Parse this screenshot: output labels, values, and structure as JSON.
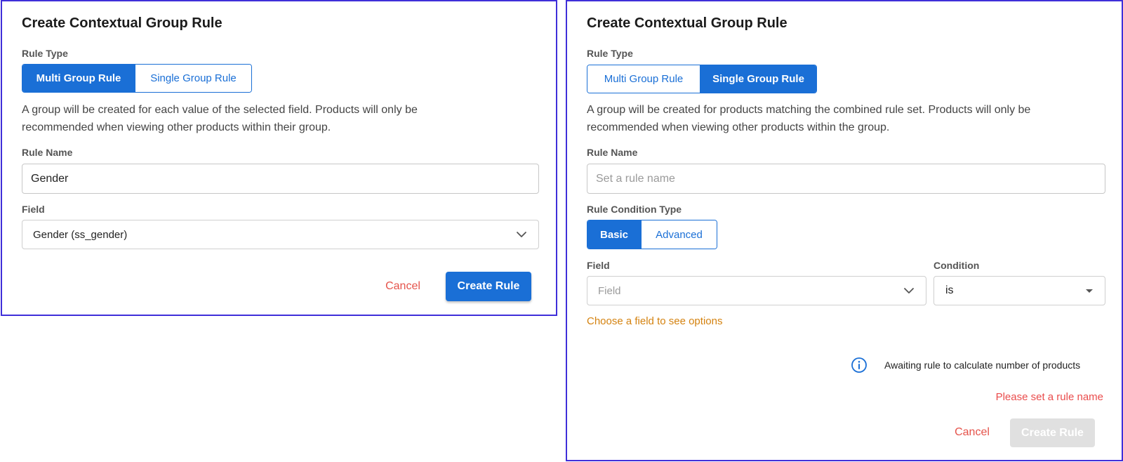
{
  "left": {
    "title": "Create Contextual Group Rule",
    "rule_type_label": "Rule Type",
    "rule_type_options": [
      "Multi Group Rule",
      "Single Group Rule"
    ],
    "rule_type_selected": "Multi Group Rule",
    "description": "A group will be created for each value of the selected field. Products will only be recommended when viewing other products within their group.",
    "rule_name_label": "Rule Name",
    "rule_name_value": "Gender",
    "field_label": "Field",
    "field_value": "Gender (ss_gender)",
    "cancel_label": "Cancel",
    "create_label": "Create Rule"
  },
  "right": {
    "title": "Create Contextual Group Rule",
    "rule_type_label": "Rule Type",
    "rule_type_options": [
      "Multi Group Rule",
      "Single Group Rule"
    ],
    "rule_type_selected": "Single Group Rule",
    "description": "A group will be created for products matching the combined rule set. Products will only be recommended when viewing other products within the group.",
    "rule_name_label": "Rule Name",
    "rule_name_placeholder": "Set a rule name",
    "condition_type_label": "Rule Condition Type",
    "condition_type_options": [
      "Basic",
      "Advanced"
    ],
    "condition_type_selected": "Basic",
    "field_label": "Field",
    "field_placeholder": "Field",
    "condition_label": "Condition",
    "condition_value": "is",
    "field_hint": "Choose a field to see options",
    "info_text": "Awaiting rule to calculate number of products",
    "error_text": "Please set a rule name",
    "cancel_label": "Cancel",
    "create_label": "Create Rule"
  },
  "colors": {
    "primary": "#1a6fd6",
    "danger": "#e5534b",
    "warning": "#d4820f",
    "panel_border": "#3f2fd9"
  },
  "icons": {
    "dropdown_chevron": "chevron-down-icon",
    "select_caret": "caret-down-icon",
    "info": "info-circle-icon"
  }
}
